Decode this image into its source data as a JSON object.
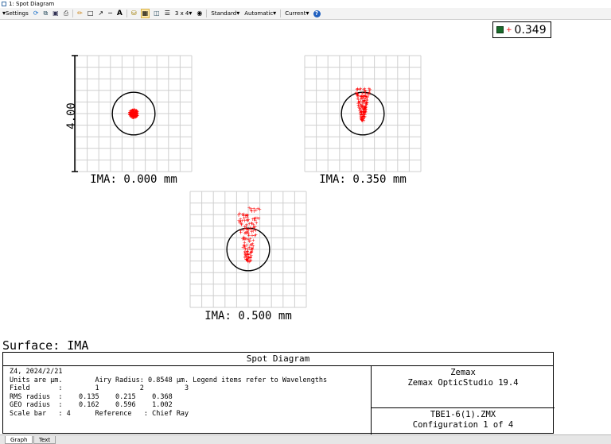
{
  "window": {
    "title": "1: Spot Diagram"
  },
  "toolbar": {
    "settings_label": "Settings",
    "layout_label": "3 x 4",
    "standard_label": "Standard",
    "automatic_label": "Automatic",
    "current_label": "Current"
  },
  "readout": {
    "value": "0.349"
  },
  "spot_chart": {
    "scale_bar_label": "4.00",
    "panels": [
      {
        "label": "IMA: 0.000 mm"
      },
      {
        "label": "IMA: 0.350 mm"
      },
      {
        "label": "IMA: 0.500 mm"
      }
    ]
  },
  "surface_label": "Surface: IMA",
  "info": {
    "title": "Spot Diagram",
    "line1": "Z4, 2024/2/21",
    "line2": "Units are µm.        Airy Radius: 0.8548 µm. Legend items refer to Wavelengths",
    "line3": "Field       :        1          2          3",
    "line4": "RMS radius  :    0.135    0.215    0.368",
    "line5": "GEO radius  :    0.162    0.596    1.002",
    "line6": "Scale bar   : 4      Reference   : Chief Ray",
    "company": "Zemax",
    "product": "Zemax OpticStudio 19.4",
    "file": "TBE1-6(1).ZMX",
    "config": "Configuration 1 of 4"
  },
  "tabs": [
    {
      "label": "Graph"
    },
    {
      "label": "Text"
    }
  ],
  "chart_data": {
    "type": "scatter",
    "units": "µm",
    "scale_bar": 4,
    "airy_radius": 0.8548,
    "spot_color": "#ff0000",
    "fields": [
      {
        "field": 1,
        "image_height_mm": 0.0,
        "rms_radius": 0.135,
        "geo_radius": 0.162
      },
      {
        "field": 2,
        "image_height_mm": 0.35,
        "rms_radius": 0.215,
        "geo_radius": 0.596
      },
      {
        "field": 3,
        "image_height_mm": 0.5,
        "rms_radius": 0.368,
        "geo_radius": 1.002
      }
    ]
  }
}
